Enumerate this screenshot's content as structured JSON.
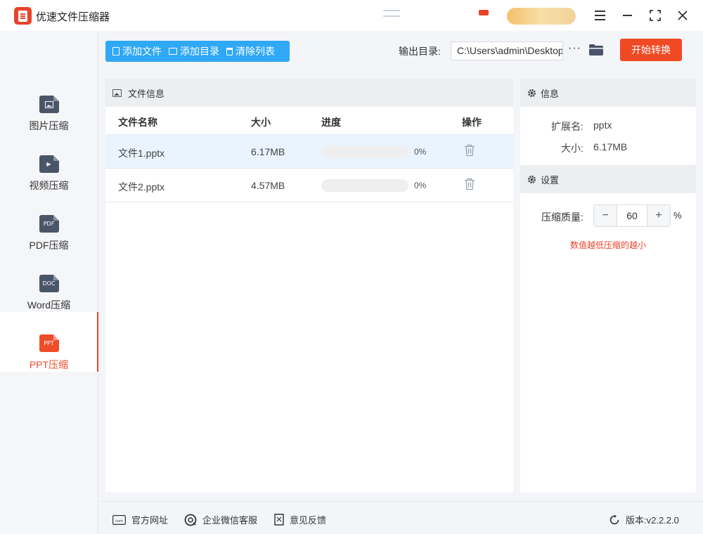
{
  "app": {
    "title": "优速文件压缩器"
  },
  "sidebar": {
    "items": [
      {
        "label": "图片压缩",
        "icon": "image-file-icon",
        "badge": "",
        "active": false
      },
      {
        "label": "视频压缩",
        "icon": "video-file-icon",
        "badge": "▶",
        "active": false
      },
      {
        "label": "PDF压缩",
        "icon": "pdf-file-icon",
        "badge": "PDF",
        "active": false
      },
      {
        "label": "Word压缩",
        "icon": "doc-file-icon",
        "badge": "DOC",
        "active": false
      },
      {
        "label": "PPT压缩",
        "icon": "ppt-file-icon",
        "badge": "PPT",
        "active": true
      }
    ]
  },
  "toolbar": {
    "add_file": "添加文件",
    "add_folder": "添加目录",
    "clear_list": "清除列表",
    "output_label": "输出目录:",
    "output_path": "C:\\Users\\admin\\Desktop",
    "more": "···",
    "start": "开始转换"
  },
  "file_panel": {
    "title": "文件信息",
    "columns": {
      "name": "文件名称",
      "size": "大小",
      "progress": "进度",
      "action": "操作"
    },
    "rows": [
      {
        "name": "文件1.pptx",
        "size": "6.17MB",
        "progress": 0,
        "progress_text": "0%",
        "selected": true
      },
      {
        "name": "文件2.pptx",
        "size": "4.57MB",
        "progress": 0,
        "progress_text": "0%",
        "selected": false
      }
    ]
  },
  "info_panel": {
    "title": "信息",
    "ext_label": "扩展名:",
    "ext_value": "pptx",
    "size_label": "大小:",
    "size_value": "6.17MB"
  },
  "settings_panel": {
    "title": "设置",
    "quality_label": "压缩质量:",
    "quality_value": "60",
    "minus": "−",
    "plus": "+",
    "unit": "%",
    "hint": "数值越低压缩的越小"
  },
  "footer": {
    "website": "官方网址",
    "wechat": "企业微信客服",
    "feedback": "意见反馈",
    "version": "版本:v2.2.2.0"
  },
  "colors": {
    "accent": "#f04a24",
    "primary": "#2fa8f5",
    "active_text": "#ee4d2a"
  }
}
